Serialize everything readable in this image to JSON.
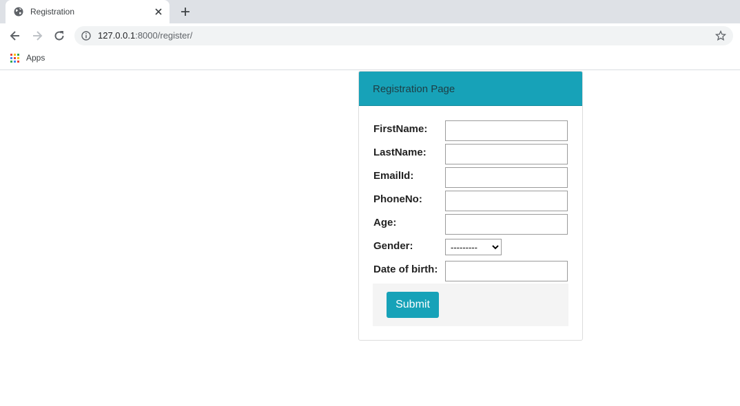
{
  "browser": {
    "tab_title": "Registration",
    "url_host": "127.0.0.1",
    "url_rest": ":8000/register/",
    "bookmark_apps": "Apps"
  },
  "form": {
    "header": "Registration Page",
    "fields": [
      {
        "label": "FirstName:",
        "value": ""
      },
      {
        "label": "LastName:",
        "value": ""
      },
      {
        "label": "EmailId:",
        "value": ""
      },
      {
        "label": "PhoneNo:",
        "value": ""
      },
      {
        "label": "Age:",
        "value": ""
      },
      {
        "label": "Gender:",
        "selected": "---------"
      },
      {
        "label": "Date of birth:",
        "value": ""
      }
    ],
    "submit_label": "Submit"
  },
  "colors": {
    "accent": "#17a2b8",
    "chrome_bg": "#dee1e6"
  }
}
